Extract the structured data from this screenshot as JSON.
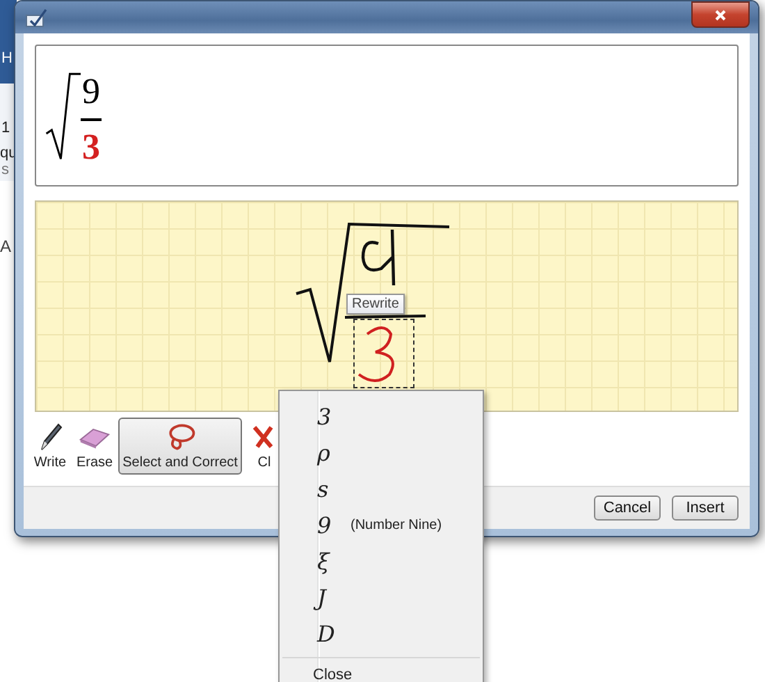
{
  "background_app": {
    "fragments": [
      "H",
      "1",
      "qu",
      "s",
      "A"
    ]
  },
  "preview": {
    "numerator": "9",
    "denominator": "3",
    "denominator_highlighted": true
  },
  "tooltip": "Rewrite",
  "tools": [
    {
      "label": "Write",
      "kind": "pen",
      "selected": false
    },
    {
      "label": "Erase",
      "kind": "eraser",
      "selected": false
    },
    {
      "label": "Select and Correct",
      "kind": "lasso",
      "selected": true
    },
    {
      "label": "Cl",
      "kind": "clear",
      "selected": false
    }
  ],
  "buttons": [
    "Cancel",
    "Insert"
  ],
  "menu": {
    "items": [
      {
        "symbol": "3"
      },
      {
        "symbol": "ρ"
      },
      {
        "symbol": "s"
      },
      {
        "symbol": "9",
        "description": "(Number Nine)"
      },
      {
        "symbol": "ξ"
      },
      {
        "symbol": "J"
      },
      {
        "symbol": "D"
      }
    ],
    "close": "Close"
  }
}
